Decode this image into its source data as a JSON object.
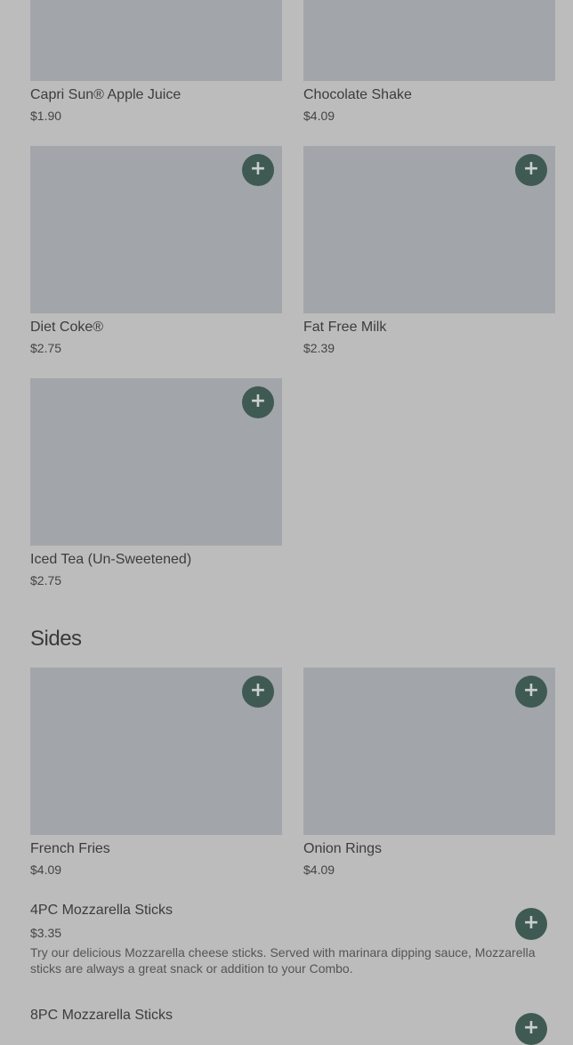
{
  "drinks": [
    {
      "name": "Capri Sun® Apple Juice",
      "price": "$1.90",
      "add_icon": "plus-icon"
    },
    {
      "name": "Chocolate Shake",
      "price": "$4.09",
      "add_icon": "plus-icon"
    },
    {
      "name": "Diet Coke®",
      "price": "$2.75",
      "add_icon": "plus-icon"
    },
    {
      "name": "Fat Free Milk",
      "price": "$2.39",
      "add_icon": "plus-icon"
    },
    {
      "name": "Iced Tea (Un-Sweetened)",
      "price": "$2.75",
      "add_icon": "plus-icon"
    }
  ],
  "sides": {
    "title": "Sides",
    "cards": [
      {
        "name": "French Fries",
        "price": "$4.09"
      },
      {
        "name": "Onion Rings",
        "price": "$4.09"
      }
    ],
    "rows": [
      {
        "name": "4PC Mozzarella Sticks",
        "price": "$3.35",
        "description": "Try our delicious Mozzarella cheese sticks. Served with marinara dipping sauce, Mozzarella sticks are always a great snack or addition to your Combo."
      },
      {
        "name": "8PC Mozzarella Sticks",
        "price": ""
      }
    ]
  },
  "add_symbol": "+",
  "colors": {
    "background": "#bcbcbc",
    "image_placeholder": "#a2a5a9",
    "add_button": "#3f5a52"
  }
}
